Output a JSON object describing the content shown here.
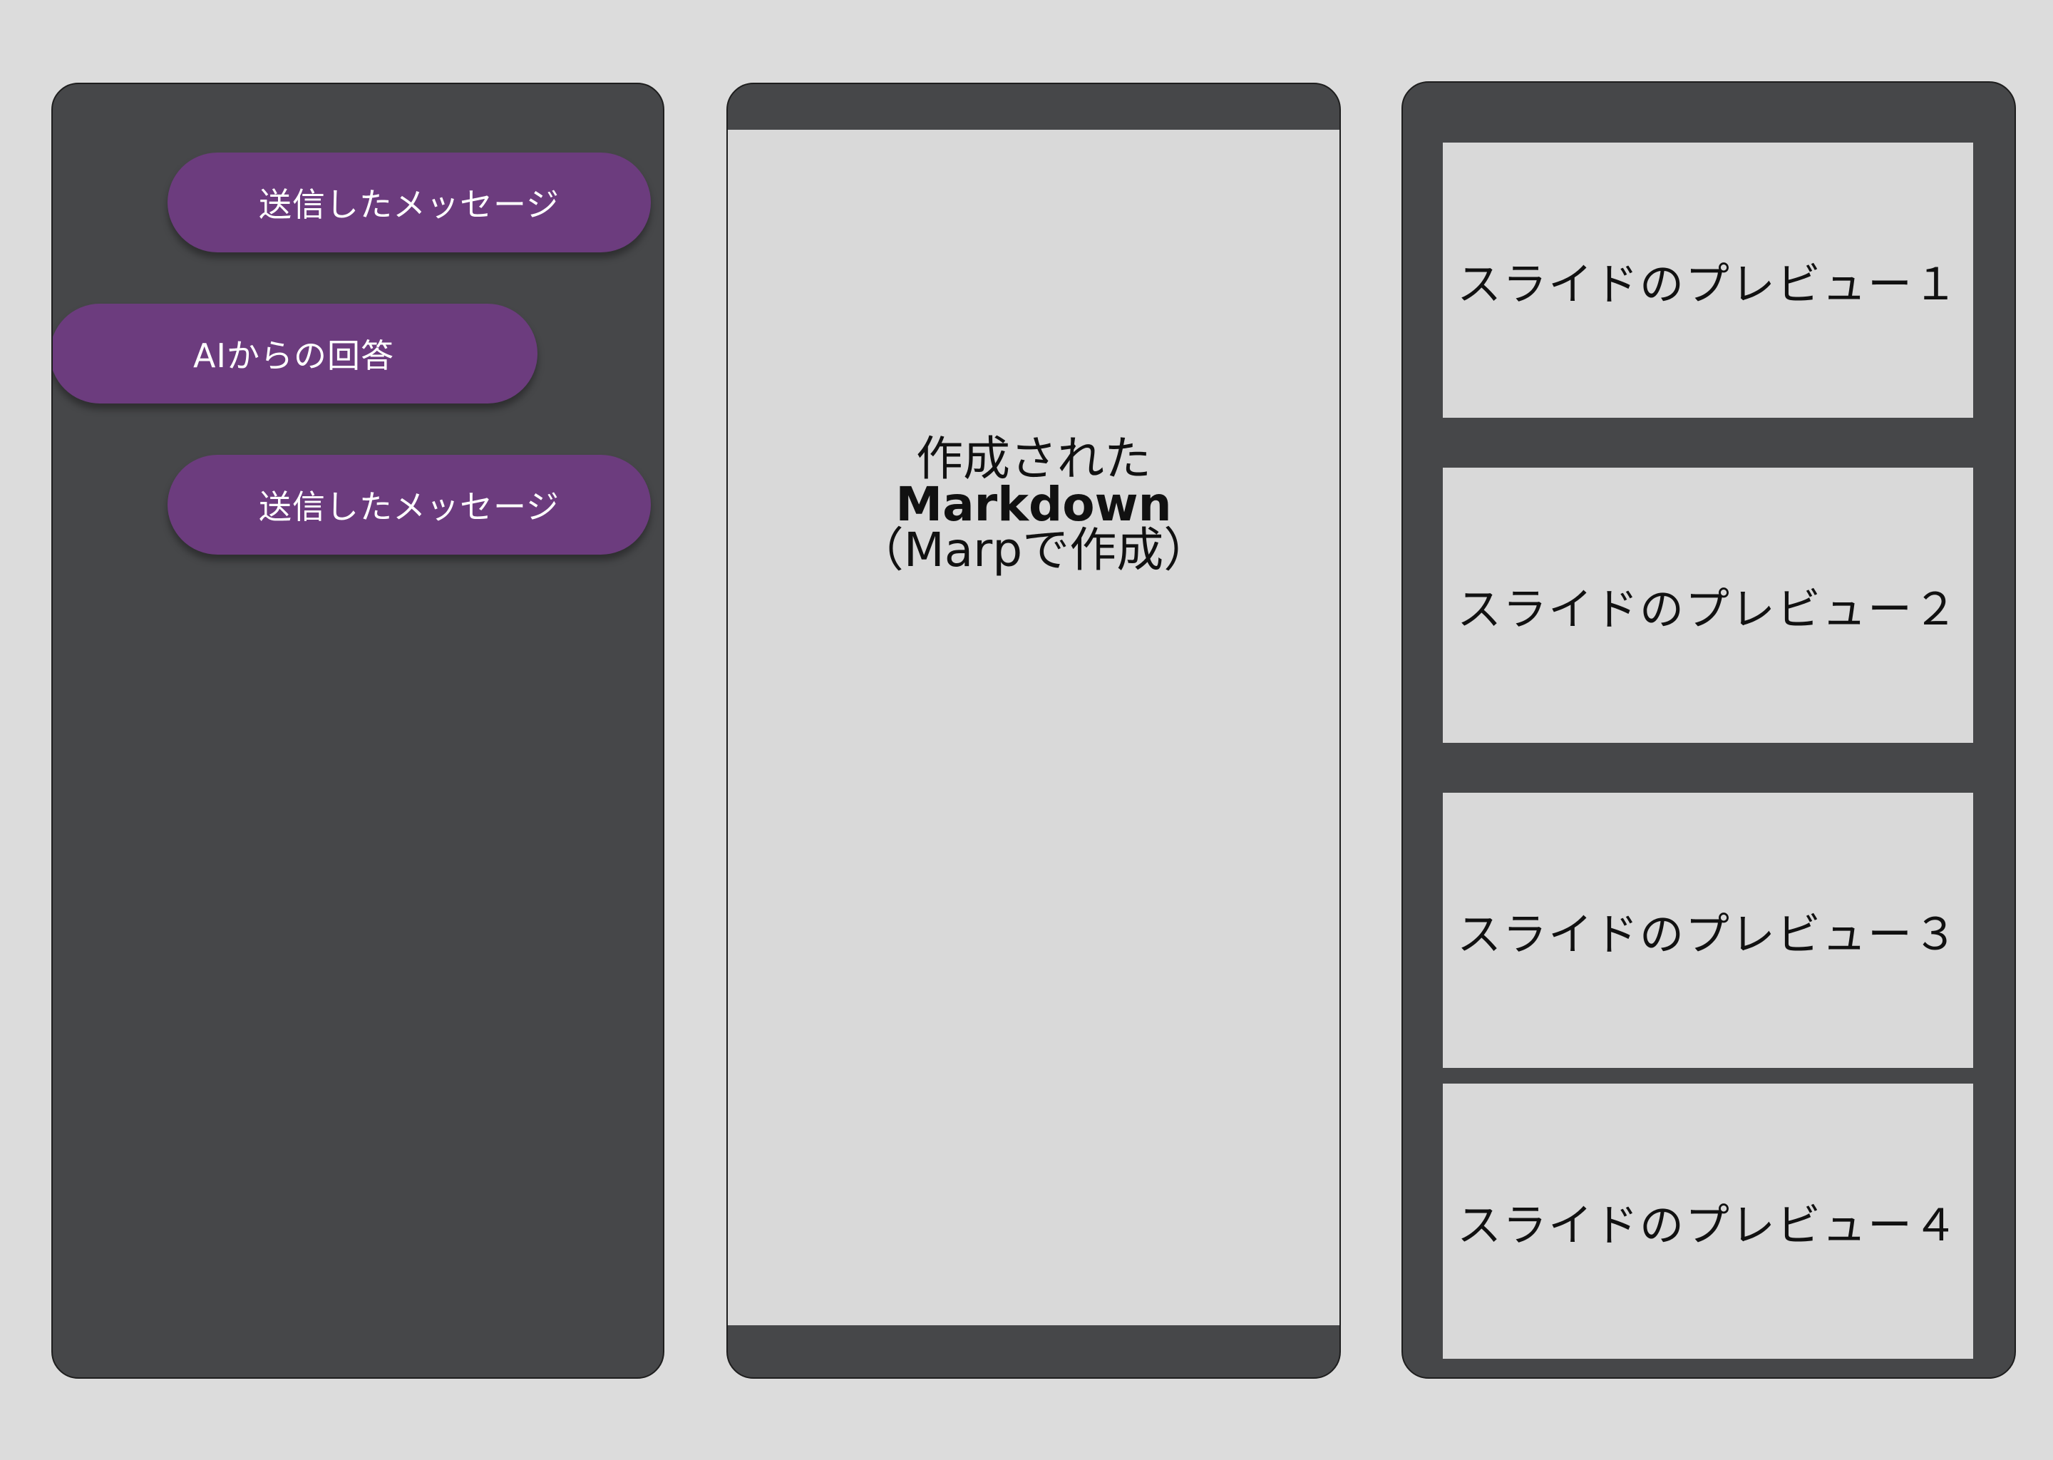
{
  "chat": {
    "messages": [
      {
        "role": "sent",
        "text": "送信したメッセージ"
      },
      {
        "role": "ai",
        "text": "AIからの回答"
      },
      {
        "role": "sent",
        "text": "送信したメッセージ"
      }
    ]
  },
  "editor": {
    "line1": "作成された",
    "line2": "Markdown",
    "line3": "（Marpで作成）"
  },
  "preview": {
    "slides": [
      {
        "label": "スライドのプレビュー１"
      },
      {
        "label": "スライドのプレビュー２"
      },
      {
        "label": "スライドのプレビュー３"
      },
      {
        "label": "スライドのプレビュー４"
      }
    ]
  },
  "colors": {
    "background": "#dcdcdc",
    "panel": "#464749",
    "bubble": "#6c3c7e",
    "content_area": "#d9d9d9"
  }
}
